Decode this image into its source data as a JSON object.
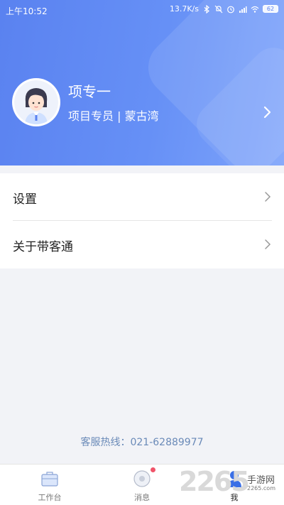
{
  "status_bar": {
    "time": "上午10:52",
    "network_speed": "13.7K/s",
    "battery": "62"
  },
  "profile": {
    "name": "项专一",
    "subtitle": "项目专员 | 蒙古湾"
  },
  "menu": {
    "items": [
      {
        "label": "设置"
      },
      {
        "label": "关于带客通"
      }
    ]
  },
  "hotline": "客服热线：021-62889977",
  "tabs": [
    {
      "label": "工作台"
    },
    {
      "label": "消息"
    },
    {
      "label": "我"
    }
  ],
  "watermark": {
    "number": "2265",
    "text": "手游网",
    "sub": "2265.com"
  },
  "colors": {
    "header_primary": "#5a82f0",
    "hotline": "#6a8ab8",
    "badge": "#f0546a"
  }
}
